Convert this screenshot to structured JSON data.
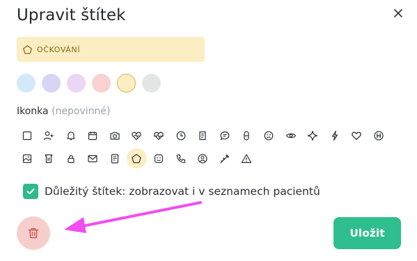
{
  "dialog": {
    "title": "Upravit štítek",
    "close_icon": "close-icon"
  },
  "tag_preview": {
    "text": "OČKOVÁNÍ",
    "icon": "pentagon-icon",
    "background": "#fbeec2",
    "text_color": "#8c6a12"
  },
  "colors": [
    {
      "name": "light-blue",
      "hex": "#d2e9f9",
      "selected": false
    },
    {
      "name": "lavender",
      "hex": "#d7d5f5",
      "selected": false
    },
    {
      "name": "light-purple",
      "hex": "#ead7f3",
      "selected": false
    },
    {
      "name": "light-red",
      "hex": "#f8d2d1",
      "selected": false
    },
    {
      "name": "light-yellow",
      "hex": "#fbeec2",
      "selected": true
    },
    {
      "name": "light-gray",
      "hex": "#e3e6e5",
      "selected": false
    }
  ],
  "icon_section": {
    "label": "Ikonka",
    "optional": "(nepovinné)"
  },
  "icons_row1": [
    "square-icon",
    "add-person-icon",
    "bell-icon",
    "calendar-icon",
    "camera-icon",
    "heart-pulse-icon",
    "heartbeat-icon",
    "clock-icon",
    "receipt-icon",
    "chat-icon",
    "pill-icon",
    "sad-face-icon",
    "eye-icon",
    "sparkle-icon",
    "lightning-icon",
    "heart-icon",
    "hospital-icon"
  ],
  "icons_row2": [
    "image-icon",
    "cup-icon",
    "lock-icon",
    "mail-icon",
    "document-icon",
    "pentagon-icon",
    "smile-icon",
    "phone-icon",
    "person-circle-icon",
    "syringe-icon",
    "warning-icon"
  ],
  "selected_icon": "pentagon-icon",
  "important": {
    "checked": true,
    "label": "Důležitý štítek: zobrazovat i v seznamech pacientů"
  },
  "actions": {
    "delete_icon": "trash-icon",
    "save_label": "Uložit"
  },
  "theme": {
    "accent": "#2fbe8f",
    "delete_bg": "#f6cfcd",
    "delete_icon_color": "#d9544f",
    "annotation_arrow": "#f04ef0"
  }
}
